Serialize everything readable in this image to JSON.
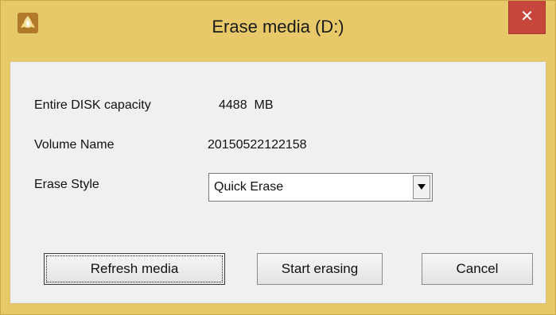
{
  "window": {
    "title": "Erase media (D:)",
    "close_symbol": "✕"
  },
  "fields": {
    "capacity_label": "Entire DISK capacity",
    "capacity_value": "4488  MB",
    "volume_label": "Volume Name",
    "volume_value": "20150522122158",
    "erase_style_label": "Erase Style",
    "erase_style_value": "Quick Erase"
  },
  "buttons": {
    "refresh": "Refresh media",
    "start": "Start erasing",
    "cancel": "Cancel"
  },
  "icons": {
    "app": "burning-disc-flame-icon",
    "close": "close-icon",
    "dropdown": "chevron-down-icon"
  },
  "colors": {
    "frame": "#e8c96a",
    "close_button": "#c7463b",
    "client_bg": "#f0f0f0"
  }
}
